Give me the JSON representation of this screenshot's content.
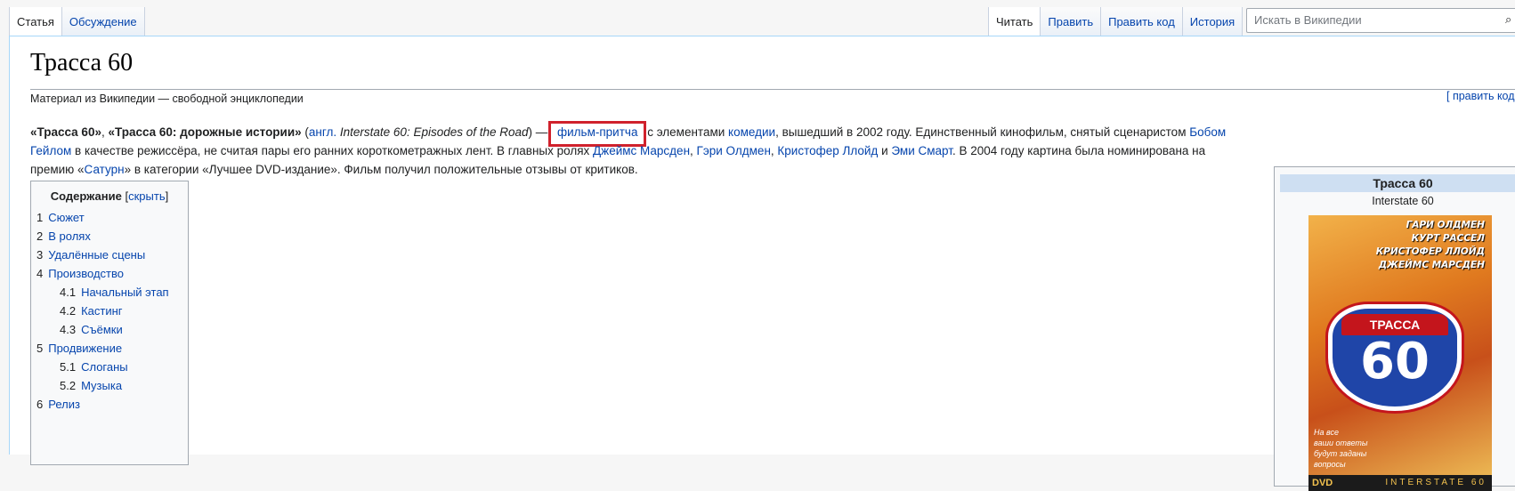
{
  "tabs": {
    "left": [
      {
        "label": "Статья",
        "selected": true
      },
      {
        "label": "Обсуждение",
        "selected": false
      }
    ],
    "right": [
      {
        "label": "Читать",
        "selected": true
      },
      {
        "label": "Править",
        "selected": false
      },
      {
        "label": "Править код",
        "selected": false
      },
      {
        "label": "История",
        "selected": false
      }
    ]
  },
  "search": {
    "placeholder": "Искать в Википедии"
  },
  "article": {
    "title": "Трасса 60",
    "tagline": "Материал из Википедии — свободной энциклопедии",
    "edit_section": "[ править код ]",
    "lead": {
      "t1": "«Трасса 60»",
      "t2": ", ",
      "t3": "«Трасса 60: дорожные истории»",
      "t4": " (",
      "t5": "англ.",
      "t6": " Interstate 60: Episodes of the Road",
      "t7": ") — ",
      "t8": "фильм-притча",
      "t9": " с элементами ",
      "t10": "комедии",
      "t11": ", вышедший в 2002 году. Единственный кинофильм, снятый сценаристом ",
      "t12": "Бобом Гейлом",
      "t13": " в качестве режиссёра, не считая пары его ранних короткометражных лент. В главных ролях ",
      "t14": "Джеймс Марсден",
      "t15": ", ",
      "t16": "Гэри Олдмен",
      "t17": ", ",
      "t18": "Кристофер Ллойд",
      "t19": " и ",
      "t20": "Эми Смарт",
      "t21": ". В 2004 году картина была номинирована на премию «",
      "t22": "Сатурн",
      "t23": "» в категории «Лучшее DVD-издание». Фильм получил положительные отзывы от критиков."
    }
  },
  "toc": {
    "title": "Содержание",
    "toggle_open": "[",
    "toggle_label": "скрыть",
    "toggle_close": "]",
    "items": [
      {
        "num": "1",
        "label": "Сюжет",
        "sub": false
      },
      {
        "num": "2",
        "label": "В ролях",
        "sub": false
      },
      {
        "num": "3",
        "label": "Удалённые сцены",
        "sub": false
      },
      {
        "num": "4",
        "label": "Производство",
        "sub": false
      },
      {
        "num": "4.1",
        "label": "Начальный этап",
        "sub": true
      },
      {
        "num": "4.2",
        "label": "Кастинг",
        "sub": true
      },
      {
        "num": "4.3",
        "label": "Съёмки",
        "sub": true
      },
      {
        "num": "5",
        "label": "Продвижение",
        "sub": false
      },
      {
        "num": "5.1",
        "label": "Слоганы",
        "sub": true
      },
      {
        "num": "5.2",
        "label": "Музыка",
        "sub": true
      },
      {
        "num": "6",
        "label": "Релиз",
        "sub": false
      }
    ]
  },
  "infobox": {
    "title": "Трасса 60",
    "subtitle": "Interstate 60",
    "poster": {
      "names": [
        "ГАРИ ОЛДМЕН",
        "КУРТ РАССЕЛ",
        "КРИСТОФЕР ЛЛОЙД",
        "ДЖЕЙМС МАРСДЕН"
      ],
      "shield_top": "ТРАССА",
      "shield_num": "60",
      "tagline": [
        "На все",
        "ваши ответы",
        "будут заданы",
        "вопросы"
      ],
      "dvd": "DVD",
      "bottom": "INTERSTATE 60"
    }
  }
}
